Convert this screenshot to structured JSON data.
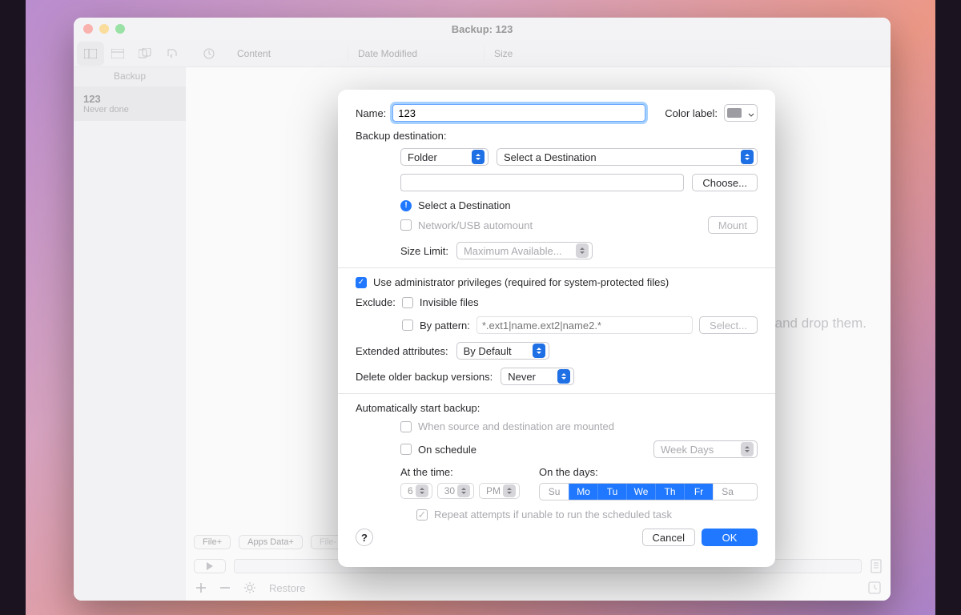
{
  "window": {
    "title": "Backup: 123"
  },
  "toolbar": {
    "time_icon": "clock-icon",
    "columns": {
      "content": "Content",
      "date": "Date Modified",
      "size": "Size"
    }
  },
  "sidebar": {
    "heading": "Backup",
    "items": [
      {
        "title": "123",
        "subtitle": "Never done"
      }
    ]
  },
  "drag_hint": "drag and drop them.",
  "bottom": {
    "file_plus": "File+",
    "apps_data_plus": "Apps Data+",
    "file_minus": "File-",
    "restore": "Restore"
  },
  "dialog": {
    "name_label": "Name:",
    "name_value": "123",
    "color_label": "Color label:",
    "dest_section": "Backup destination:",
    "dest_type": "Folder",
    "dest_select": "Select a Destination",
    "choose": "Choose...",
    "dest_warning": "Select a Destination",
    "automount": "Network/USB automount",
    "mount": "Mount",
    "size_limit_label": "Size Limit:",
    "size_limit_value": "Maximum Available...",
    "admin_priv": "Use administrator privileges (required for system-protected files)",
    "exclude_label": "Exclude:",
    "invisible": "Invisible files",
    "by_pattern": "By pattern:",
    "pattern_ph": "*.ext1|name.ext2|name2.*",
    "select_btn": "Select...",
    "ext_attr_label": "Extended attributes:",
    "ext_attr_value": "By Default",
    "delete_older_label": "Delete older backup versions:",
    "delete_older_value": "Never",
    "auto_section": "Automatically start backup:",
    "when_mounted": "When source and destination are mounted",
    "on_schedule": "On schedule",
    "schedule_mode": "Week Days",
    "at_time": "At the time:",
    "on_days": "On the days:",
    "time_h": "6",
    "time_m": "30",
    "time_ap": "PM",
    "days": [
      {
        "abbr": "Su",
        "on": false
      },
      {
        "abbr": "Mo",
        "on": true
      },
      {
        "abbr": "Tu",
        "on": true
      },
      {
        "abbr": "We",
        "on": true
      },
      {
        "abbr": "Th",
        "on": true
      },
      {
        "abbr": "Fr",
        "on": true
      },
      {
        "abbr": "Sa",
        "on": false
      }
    ],
    "repeat": "Repeat attempts if unable to run the scheduled task",
    "cancel": "Cancel",
    "ok": "OK"
  }
}
